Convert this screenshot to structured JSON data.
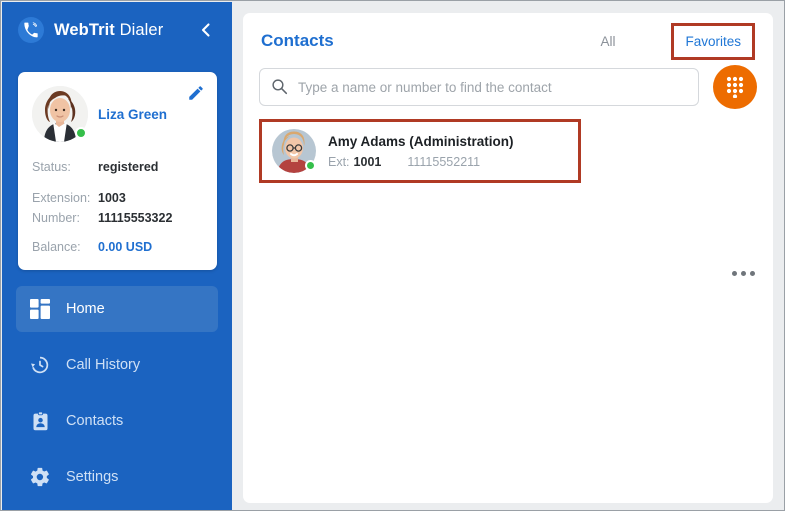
{
  "sidebar": {
    "brand_bold": "WebTrit",
    "brand_light": " Dialer",
    "logo_icon": "phone-call-icon",
    "collapse_icon": "chevron-left-icon",
    "profile": {
      "name": "Liza Green",
      "avatar_icon": "user-avatar-photo",
      "presence": "online",
      "edit_icon": "pencil-edit-icon",
      "rows": [
        {
          "label": "Status:",
          "value": "registered",
          "accent": false
        },
        {
          "label": "Extension:",
          "value": "1003",
          "accent": false
        },
        {
          "label": "Number:",
          "value": "11115553322",
          "accent": false
        },
        {
          "label": "Balance:",
          "value": "0.00 USD",
          "accent": true
        }
      ]
    },
    "items": [
      {
        "label": "Home",
        "icon": "dashboard-icon",
        "active": true
      },
      {
        "label": "Call History",
        "icon": "clock-history-icon",
        "active": false
      },
      {
        "label": "Contacts",
        "icon": "contact-card-icon",
        "active": false
      },
      {
        "label": "Settings",
        "icon": "gear-icon",
        "active": false
      }
    ]
  },
  "main": {
    "title": "Contacts",
    "tabs": [
      {
        "label": "All",
        "active": false
      },
      {
        "label": "Favorites",
        "active": true
      }
    ],
    "search": {
      "placeholder": "Type a name or number to find the contact",
      "value": "",
      "icon": "search-icon"
    },
    "dialpad_button": {
      "icon": "dialpad-icon"
    },
    "contacts": [
      {
        "name": "Amy Adams (Administration)",
        "ext_label": "Ext:",
        "ext_value": "1001",
        "number": "11115552211",
        "presence": "online",
        "avatar_icon": "contact-avatar-photo",
        "menu_icon": "more-horizontal-icon"
      }
    ]
  },
  "colors": {
    "sidebar_blue": "#1b63c0",
    "active_blue": "#3575c4",
    "accent_blue": "#1f6fd0",
    "orange": "#ed6c00",
    "online_green": "#35bf4a",
    "annotation_red": "#b03a24",
    "page_bg": "#ebedef"
  }
}
